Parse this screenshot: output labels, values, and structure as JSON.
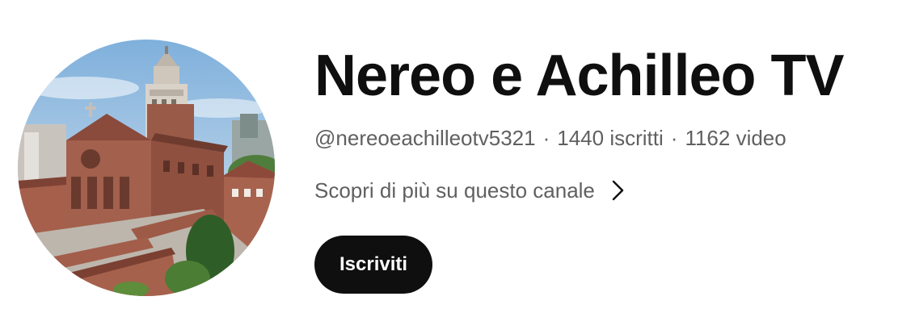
{
  "channel": {
    "name": "Nereo e Achilleo TV",
    "handle": "@nereoeachilleotv5321",
    "subscribers": "1440 iscritti",
    "videos": "1162 video",
    "separator": "·",
    "about_link": "Scopri di più su questo canale",
    "subscribe_label": "Iscriviti",
    "avatar_icon": "church-photo-avatar",
    "chevron_icon": "chevron-right-icon"
  },
  "colors": {
    "text_primary": "#0f0f0f",
    "text_secondary": "#606060",
    "button_bg": "#0f0f0f",
    "button_text": "#ffffff",
    "background": "#ffffff"
  }
}
